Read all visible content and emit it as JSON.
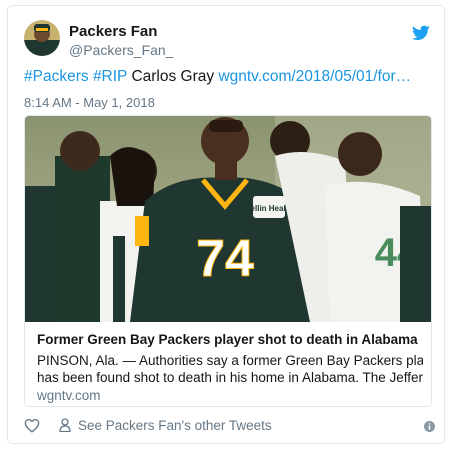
{
  "user": {
    "name": "Packers Fan",
    "handle": "@Packers_Fan_"
  },
  "tweet": {
    "hashtag1": "#Packers",
    "hashtag2": "#RIP",
    "text": "Carlos Gray",
    "link": "wgntv.com/2018/05/01/for…",
    "timestamp": "8:14 AM - May 1, 2018"
  },
  "card": {
    "headline": "Former Green Bay Packers player shot to death in Alabama",
    "description_line1": "PINSON, Ala. — Authorities say a former Green Bay Packers player",
    "description_line2": "has been found shot to death in his home in Alabama. The Jefferson",
    "domain": "wgntv.com",
    "jersey_number": "74",
    "chest_patch": "Bellin Health"
  },
  "footer": {
    "other_tweets": "See Packers Fan's other Tweets"
  },
  "colors": {
    "link": "#1b95e0",
    "muted": "#657786",
    "packers_green": "#203731",
    "packers_gold": "#ffb612"
  },
  "icons": [
    "twitter-bird-icon",
    "heart-icon",
    "person-icon",
    "info-icon"
  ]
}
